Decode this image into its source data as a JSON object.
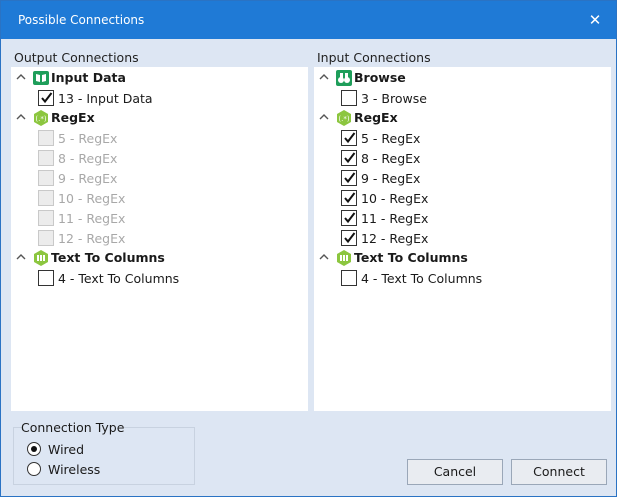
{
  "window": {
    "title": "Possible Connections",
    "close_glyph": "✕"
  },
  "output": {
    "label": "Output Connections",
    "groups": [
      {
        "name": "Input Data",
        "icon": "book-icon",
        "color": "#1e9e5a",
        "items": [
          {
            "label": "13 - Input Data",
            "checked": true,
            "enabled": true
          }
        ]
      },
      {
        "name": "RegEx",
        "icon": "regex-icon",
        "color": "#8cc63f",
        "items": [
          {
            "label": "5 - RegEx",
            "checked": false,
            "enabled": false
          },
          {
            "label": "8 - RegEx",
            "checked": false,
            "enabled": false
          },
          {
            "label": "9 - RegEx",
            "checked": false,
            "enabled": false
          },
          {
            "label": "10 - RegEx",
            "checked": false,
            "enabled": false
          },
          {
            "label": "11 - RegEx",
            "checked": false,
            "enabled": false
          },
          {
            "label": "12 - RegEx",
            "checked": false,
            "enabled": false
          }
        ]
      },
      {
        "name": "Text To Columns",
        "icon": "text-to-columns-icon",
        "color": "#8cc63f",
        "items": [
          {
            "label": "4 - Text To Columns",
            "checked": false,
            "enabled": true
          }
        ]
      }
    ]
  },
  "input": {
    "label": "Input Connections",
    "groups": [
      {
        "name": "Browse",
        "icon": "binoculars-icon",
        "color": "#1e9e5a",
        "items": [
          {
            "label": "3 - Browse",
            "checked": false,
            "enabled": true
          }
        ]
      },
      {
        "name": "RegEx",
        "icon": "regex-icon",
        "color": "#8cc63f",
        "items": [
          {
            "label": "5 - RegEx",
            "checked": true,
            "enabled": true
          },
          {
            "label": "8 - RegEx",
            "checked": true,
            "enabled": true
          },
          {
            "label": "9 - RegEx",
            "checked": true,
            "enabled": true
          },
          {
            "label": "10 - RegEx",
            "checked": true,
            "enabled": true
          },
          {
            "label": "11 - RegEx",
            "checked": true,
            "enabled": true
          },
          {
            "label": "12 - RegEx",
            "checked": true,
            "enabled": true
          }
        ]
      },
      {
        "name": "Text To Columns",
        "icon": "text-to-columns-icon",
        "color": "#8cc63f",
        "items": [
          {
            "label": "4 - Text To Columns",
            "checked": false,
            "enabled": true
          }
        ]
      }
    ]
  },
  "connection_type": {
    "label": "Connection Type",
    "options": [
      {
        "label": "Wired",
        "selected": true
      },
      {
        "label": "Wireless",
        "selected": false
      }
    ]
  },
  "buttons": {
    "cancel": "Cancel",
    "connect": "Connect"
  }
}
